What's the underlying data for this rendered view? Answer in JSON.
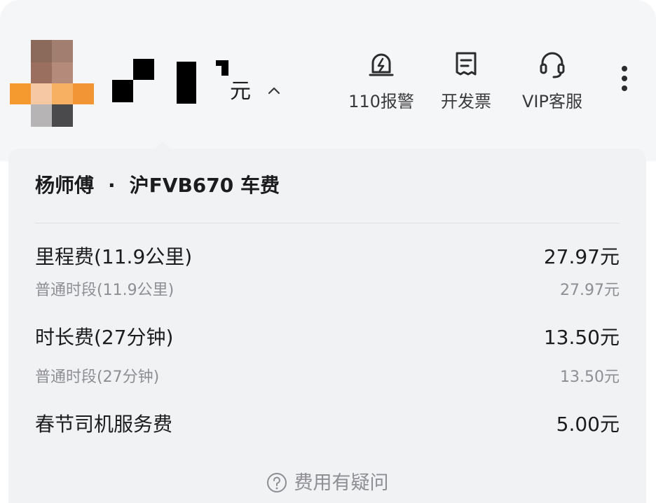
{
  "header": {
    "fare_unit": "元",
    "actions": [
      {
        "label": "110报警",
        "icon": "alarm-icon"
      },
      {
        "label": "开发票",
        "icon": "invoice-icon"
      },
      {
        "label": "VIP客服",
        "icon": "headset-icon"
      }
    ],
    "more_icon": "more-vertical-icon",
    "expand_icon": "chevron-up-icon"
  },
  "card": {
    "driver": "杨师傅",
    "separator": "·",
    "title_suffix": "沪FVB670 车费",
    "items": [
      {
        "name": "里程费(11.9公里)",
        "amount": "27.97元",
        "level": "main"
      },
      {
        "name": "普通时段(11.9公里)",
        "amount": "27.97元",
        "level": "sub"
      },
      {
        "name": "时长费(27分钟)",
        "amount": "13.50元",
        "level": "main"
      },
      {
        "name": "普通时段(27分钟)",
        "amount": "13.50元",
        "level": "sub"
      },
      {
        "name": "春节司机服务费",
        "amount": "5.00元",
        "level": "main"
      }
    ],
    "question_label": "费用有疑问",
    "question_icon": "question-circle-icon"
  },
  "colors": {
    "panel_background": "#f5f6f8",
    "card_background": "#f1f2f4",
    "primary_text": "#1c1c1e",
    "secondary_text": "#8e8e93"
  }
}
